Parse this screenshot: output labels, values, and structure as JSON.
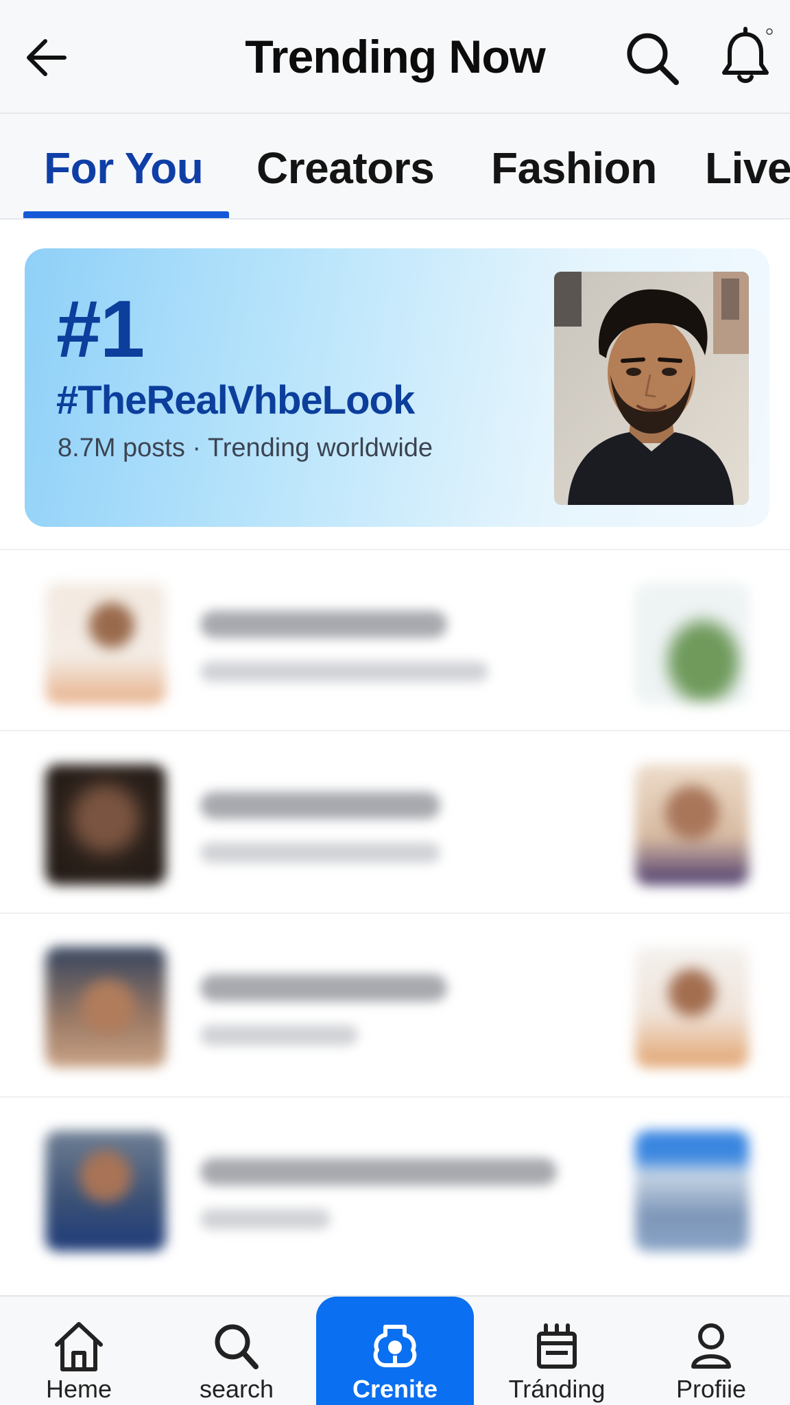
{
  "header": {
    "title": "Trending Now",
    "back_icon": "arrow-left-icon",
    "search_icon": "search-icon",
    "bell_icon": "bell-icon"
  },
  "tabs": [
    {
      "label": "For You",
      "active": true
    },
    {
      "label": "Creators",
      "active": false
    },
    {
      "label": "Fashion",
      "active": false
    },
    {
      "label": "Live",
      "active": false
    }
  ],
  "featured": {
    "rank": "#1",
    "hashtag": "#TheRealVhbeLook",
    "meta": "8.7M posts · Trending worldwide"
  },
  "bottom_nav": [
    {
      "label": "Heme",
      "icon": "home-icon"
    },
    {
      "label": "search",
      "icon": "search-icon"
    },
    {
      "label": "Crenite",
      "icon": "create-icon",
      "highlighted": true
    },
    {
      "label": "Tránding",
      "icon": "trending-icon"
    },
    {
      "label": "Profiie",
      "icon": "profile-icon"
    }
  ],
  "colors": {
    "accent": "#1659d6",
    "tab_active": "#0f3fa6",
    "create_button": "#0a6ff0",
    "feature_text": "#0c3e9c"
  }
}
